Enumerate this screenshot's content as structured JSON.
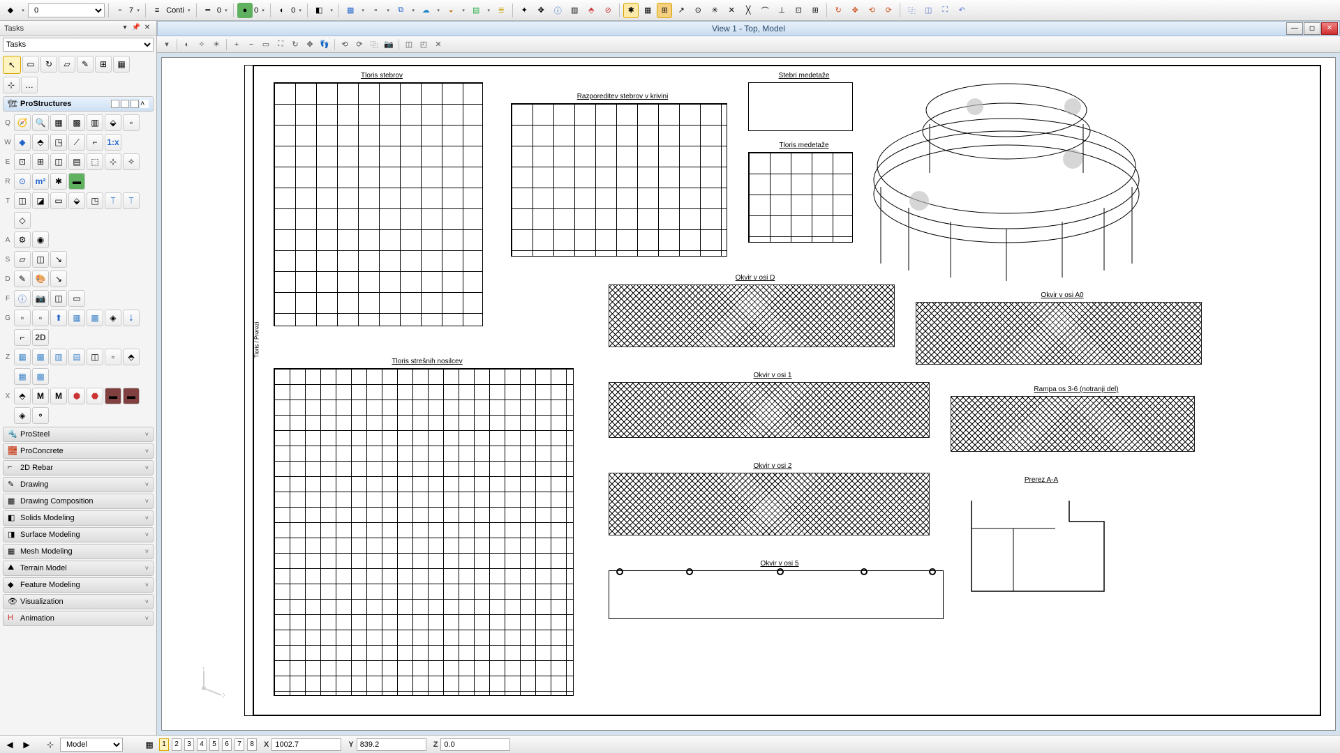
{
  "top_toolbar": {
    "level_combo": "0",
    "models_count": "7",
    "linestyle": "Conti",
    "lineweight": "0",
    "color1": "0",
    "color2": "0"
  },
  "tasks_panel": {
    "title": "Tasks",
    "combo": "Tasks",
    "active_section": "ProStructures",
    "row_labels": [
      "Q",
      "W",
      "E",
      "R",
      "T",
      "A",
      "S",
      "D",
      "F",
      "G",
      "Z",
      "X"
    ],
    "collapsed_sections": [
      "ProSteel",
      "ProConcrete",
      "2D Rebar",
      "Drawing",
      "Drawing Composition",
      "Solids Modeling",
      "Surface Modeling",
      "Mesh Modeling",
      "Terrain Model",
      "Feature Modeling",
      "Visualization",
      "Animation"
    ]
  },
  "view": {
    "title": "View 1 - Top, Model",
    "drawings": {
      "d1": "Tloris stebrov",
      "d2": "Razporeditev stebrov v krivini",
      "d3": "Stebri medetaže",
      "d4": "Tloris medetaže",
      "d5": "Okvir v osi D",
      "d6": "Okvir v osi A0",
      "d7": "Tloris strešnih nosilcev",
      "d8": "Okvir v osi 1",
      "d9": "Okvir v osi 2",
      "d10": "Rampa os 3-6 (notranji del)",
      "d11": "Okvir v osi 5",
      "d12": "Prerez A-A"
    },
    "vert_note": "Tloris / Prerezi"
  },
  "status": {
    "model_combo": "Model",
    "view_nums": [
      "1",
      "2",
      "3",
      "4",
      "5",
      "6",
      "7",
      "8"
    ],
    "active_view": "1",
    "x_label": "X",
    "y_label": "Y",
    "z_label": "Z",
    "x": "1002.7",
    "y": "839.2",
    "z": "0.0"
  }
}
